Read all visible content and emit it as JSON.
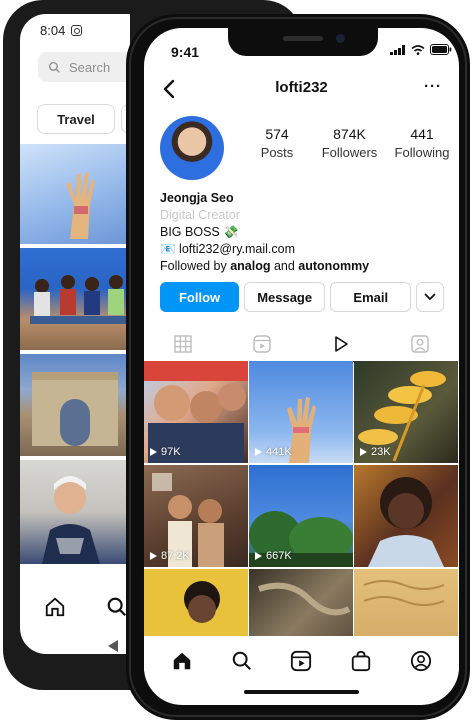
{
  "back_phone": {
    "time": "8:04",
    "search_placeholder": "Search",
    "chip_label": "Travel"
  },
  "front_phone": {
    "status": {
      "time": "9:41"
    },
    "header": {
      "username": "lofti232",
      "more": "···"
    },
    "profile": {
      "stats": [
        {
          "value": "574",
          "label": "Posts"
        },
        {
          "value": "874K",
          "label": "Followers"
        },
        {
          "value": "441",
          "label": "Following"
        }
      ],
      "name": "Jeongja Seo",
      "category": "Digital Creator",
      "bio_line": "BIG BOSS 💸",
      "email_line": "📧 lofti232@ry.mail.com",
      "followed_prefix": "Followed by ",
      "followed_user1": "analog",
      "followed_joiner": " and ",
      "followed_user2": "autonommy"
    },
    "actions": {
      "follow": "Follow",
      "message": "Message",
      "email": "Email"
    },
    "grid": [
      {
        "views": "97K",
        "color": "#c85a3c"
      },
      {
        "views": "441K",
        "color": "#6aa0e0"
      },
      {
        "views": "23K",
        "color": "#5a5a3a"
      },
      {
        "views": "",
        "color": "#6b4a3a"
      },
      {
        "views": "",
        "color": "#3c7bd0"
      },
      {
        "views": "",
        "color": "#5a3020"
      },
      {
        "views": "87.2K",
        "color": "#8a6a52"
      },
      {
        "views": "667K",
        "color": "#2f7a3a"
      },
      {
        "views": "",
        "color": "#d4b060"
      }
    ]
  },
  "colors": {
    "accent": "#0095f6",
    "text": "#111111",
    "muted": "#c8c8c8"
  }
}
